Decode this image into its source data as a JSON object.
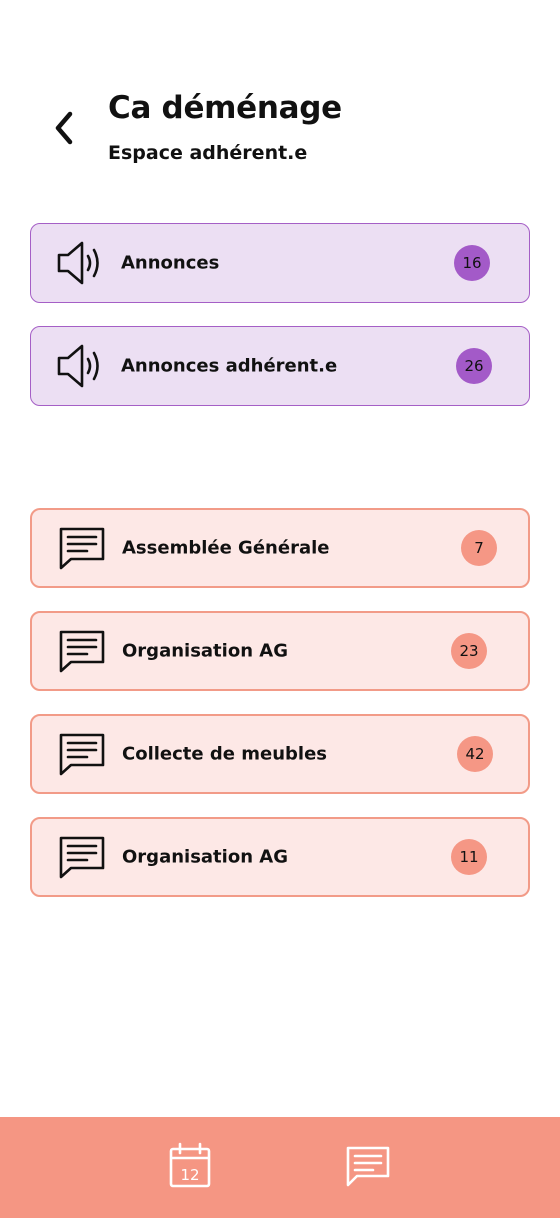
{
  "header": {
    "back_icon": "chevron-left-icon",
    "title": "Ca déménage",
    "subtitle": "Espace adhérent.e"
  },
  "announcements": [
    {
      "label": "Annonces",
      "count": "16",
      "icon": "speaker-icon"
    },
    {
      "label": "Annonces adhérent.e",
      "count": "26",
      "icon": "speaker-icon"
    }
  ],
  "discussions": [
    {
      "label": "Assemblée Générale",
      "count": "7",
      "icon": "message-icon"
    },
    {
      "label": "Organisation AG",
      "count": "23",
      "icon": "message-icon"
    },
    {
      "label": "Collecte de meubles",
      "count": "42",
      "icon": "message-icon"
    },
    {
      "label": "Organisation AG",
      "count": "11",
      "icon": "message-icon"
    }
  ],
  "bottom_nav": {
    "calendar_icon": "calendar-icon",
    "calendar_day": "12",
    "messages_icon": "message-icon"
  },
  "colors": {
    "announce_bg": "#ecdff3",
    "announce_border": "#a55fc6",
    "announce_badge": "#a35ac8",
    "discussion_bg": "#fde8e6",
    "discussion_border": "#f29b88",
    "discussion_badge": "#f59785",
    "bottom_bar": "#f59683"
  }
}
